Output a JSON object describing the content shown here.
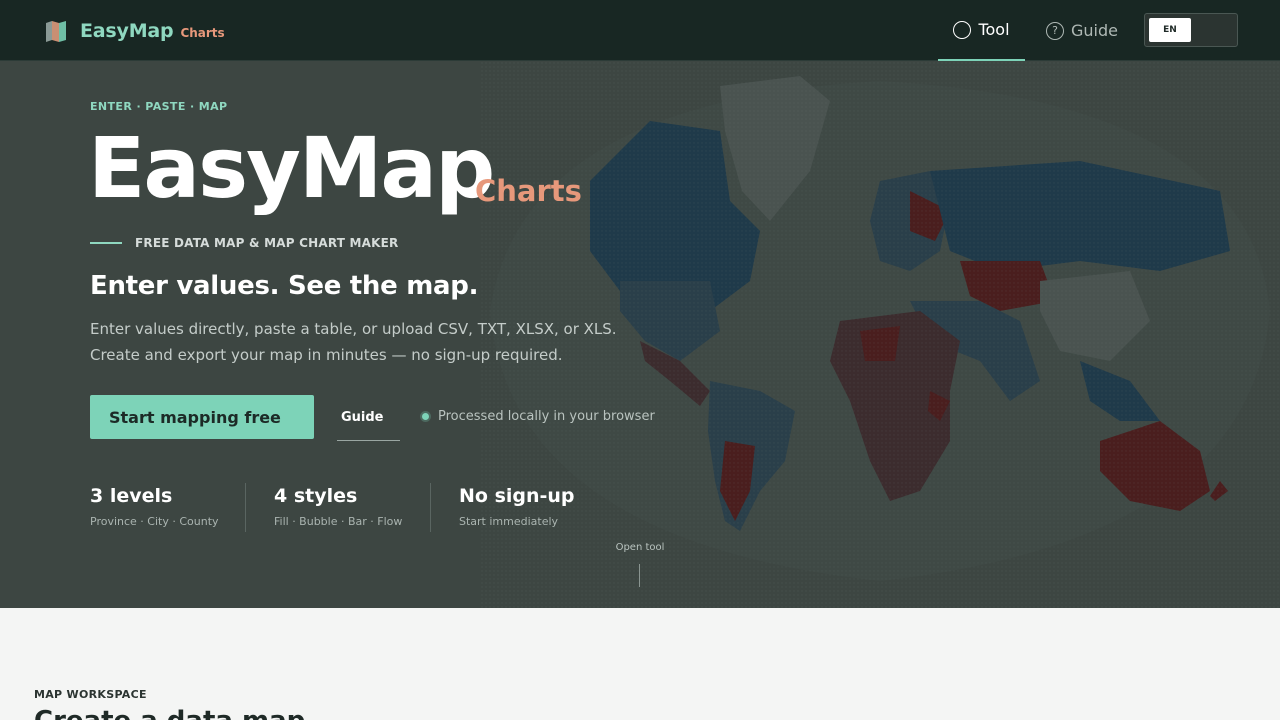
{
  "nav": {
    "brand": "EasyMap",
    "brand_sub": "Charts",
    "tool_label": "Tool",
    "guide_label": "Guide",
    "lang": "EN"
  },
  "hero": {
    "eyebrow": "ENTER · PASTE · MAP",
    "title": "EasyMap",
    "title_sub": "Charts",
    "tagline": "FREE DATA MAP & MAP CHART MAKER",
    "headline": "Enter values. See the map.",
    "description": "Enter values directly, paste a table, or upload CSV, TXT, XLSX, or XLS. Create and export your map in minutes — no sign-up required.",
    "cta_label": "Start mapping free",
    "guide_link": "Guide",
    "local_note": "Processed locally in your browser",
    "stats": [
      {
        "title": "3 levels",
        "sub": "Province · City · County"
      },
      {
        "title": "4 styles",
        "sub": "Fill · Bubble · Bar · Flow"
      },
      {
        "title": "No sign-up",
        "sub": "Start immediately"
      }
    ],
    "open_tool": "Open tool"
  },
  "section": {
    "label": "MAP WORKSPACE",
    "title": "Create a data map"
  },
  "colors": {
    "accent": "#7dd3b8",
    "brand_orange": "#e7987b",
    "nav_bg": "#182723",
    "hero_bg": "#3d4642",
    "map_blue": "#1f3a4a",
    "map_red": "#4a1e1e"
  }
}
